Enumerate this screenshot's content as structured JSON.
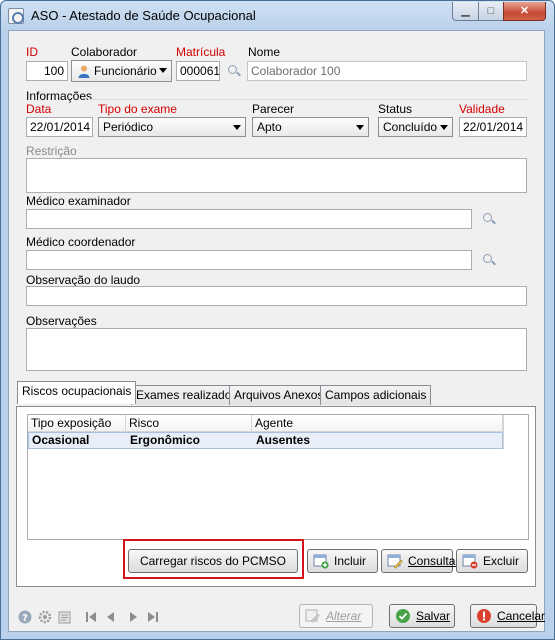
{
  "window": {
    "title": "ASO - Atestado de Saúde Ocupacional"
  },
  "header": {
    "id_label": "ID",
    "id_value": "100",
    "colaborador_label": "Colaborador",
    "colaborador_value": "Funcionário",
    "matricula_label": "Matrícula",
    "matricula_value": "000061",
    "nome_label": "Nome",
    "nome_value": "Colaborador 100"
  },
  "informacoes": {
    "group_label": "Informações",
    "data_label": "Data",
    "data_value": "22/01/2014",
    "tipo_label": "Tipo do exame",
    "tipo_value": "Periódico",
    "parecer_label": "Parecer",
    "parecer_value": "Apto",
    "status_label": "Status",
    "status_value": "Concluído",
    "validade_label": "Validade",
    "validade_value": "22/01/2014",
    "restricao_label": "Restrição",
    "medico_examinador_label": "Médico examinador",
    "medico_coordenador_label": "Médico coordenador",
    "observacao_laudo_label": "Observação do laudo",
    "observacoes_label": "Observações"
  },
  "tabs": [
    {
      "label": "Riscos ocupacionais",
      "active": true
    },
    {
      "label": "Exames realizados"
    },
    {
      "label": "Arquivos Anexos"
    },
    {
      "label": "Campos adicionais"
    }
  ],
  "grid": {
    "columns": [
      "Tipo exposição",
      "Risco",
      "Agente"
    ],
    "rows": [
      [
        "Ocasional",
        "Ergonômico",
        "Ausentes"
      ]
    ]
  },
  "panel_buttons": {
    "carregar": "Carregar riscos do PCMSO",
    "incluir": "Incluir",
    "consultar": "Consultar",
    "excluir": "Excluir"
  },
  "footer_buttons": {
    "alterar": "Alterar",
    "salvar": "Salvar",
    "cancelar": "Cancelar"
  },
  "colors": {
    "required_label": "#d40000",
    "highlight_box": "#d4141b",
    "selected_row": "#e8eef7"
  }
}
